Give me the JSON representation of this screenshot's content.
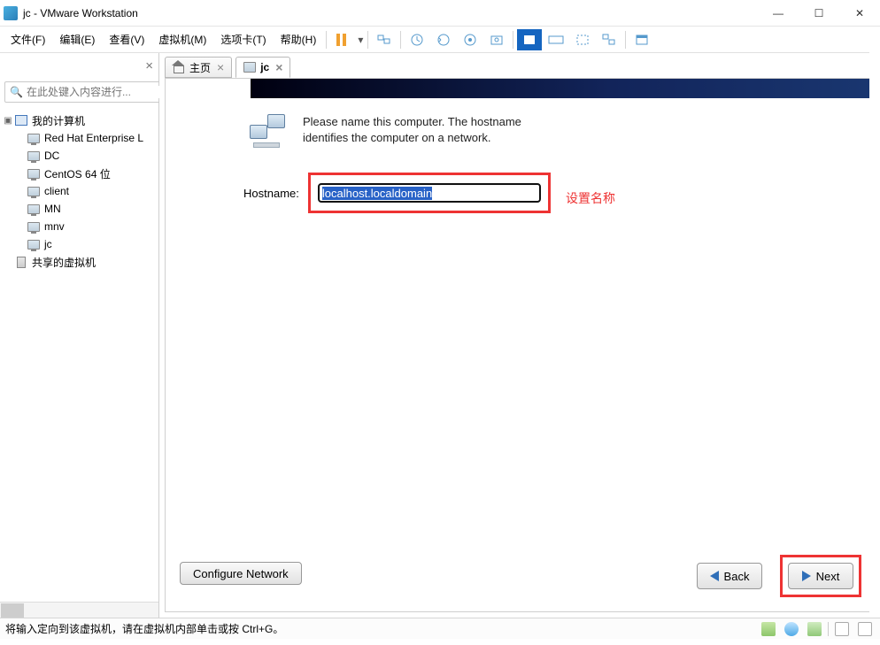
{
  "window": {
    "title": "jc - VMware Workstation"
  },
  "menu": {
    "file": "文件(F)",
    "edit": "编辑(E)",
    "view": "查看(V)",
    "vm": "虚拟机(M)",
    "tabs": "选项卡(T)",
    "help": "帮助(H)"
  },
  "sidebar": {
    "search_placeholder": "在此处键入内容进行...",
    "root": "我的计算机",
    "items": [
      "Red Hat Enterprise L",
      "DC",
      "CentOS 64 位",
      "client",
      "MN",
      "mnv",
      "jc"
    ],
    "shared": "共享的虚拟机"
  },
  "tabs": {
    "home": "主页",
    "jc": "jc"
  },
  "installer": {
    "intro": "Please name this computer.  The hostname identifies the computer on a network.",
    "hostname_label": "Hostname:",
    "hostname_value": "localhost.localdomain",
    "configure_network": "Configure Network",
    "back": "Back",
    "next": "Next"
  },
  "annotation": "设置名称",
  "status": {
    "message": "将输入定向到该虚拟机，请在虚拟机内部单击或按 Ctrl+G。"
  }
}
